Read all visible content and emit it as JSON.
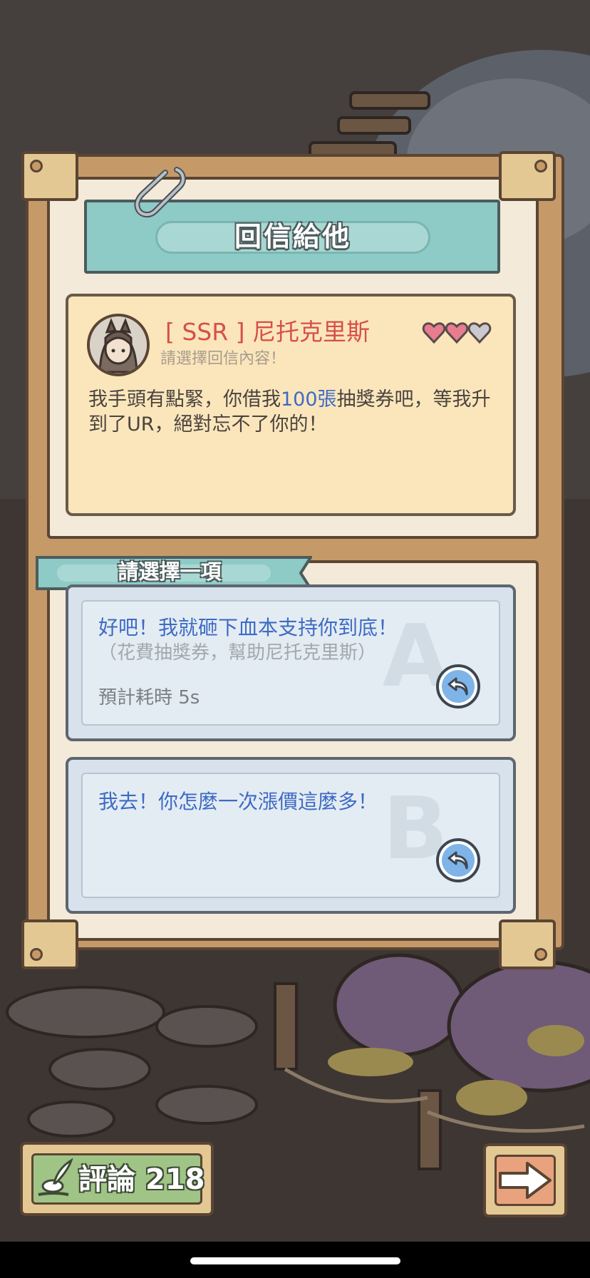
{
  "title": "回信給他",
  "sender": {
    "name": "[ SSR ] 尼托克里斯",
    "hint": "請選擇回信內容！",
    "hearts": {
      "filled": 2,
      "total": 3
    },
    "message_before": "我手頭有點緊，你借我",
    "message_highlight": "100張",
    "message_after": "抽獎券吧，等我升到了UR，絕對忘不了你的！"
  },
  "choose_label": "請選擇一項",
  "options": [
    {
      "letter": "A",
      "title": "好吧！我就砸下血本支持你到底！",
      "subtitle": "（花費抽獎券，幫助尼托克里斯）",
      "time": "預計耗時  5s"
    },
    {
      "letter": "B",
      "title": "我去！你怎麼一次漲價這麼多！"
    }
  ],
  "comment_button": {
    "label": "評論 218"
  },
  "colors": {
    "name_red": "#d5504a",
    "option_blue": "#3d6bc4",
    "banner_teal": "#8ecac6",
    "heart_pink": "#e77d8f"
  }
}
